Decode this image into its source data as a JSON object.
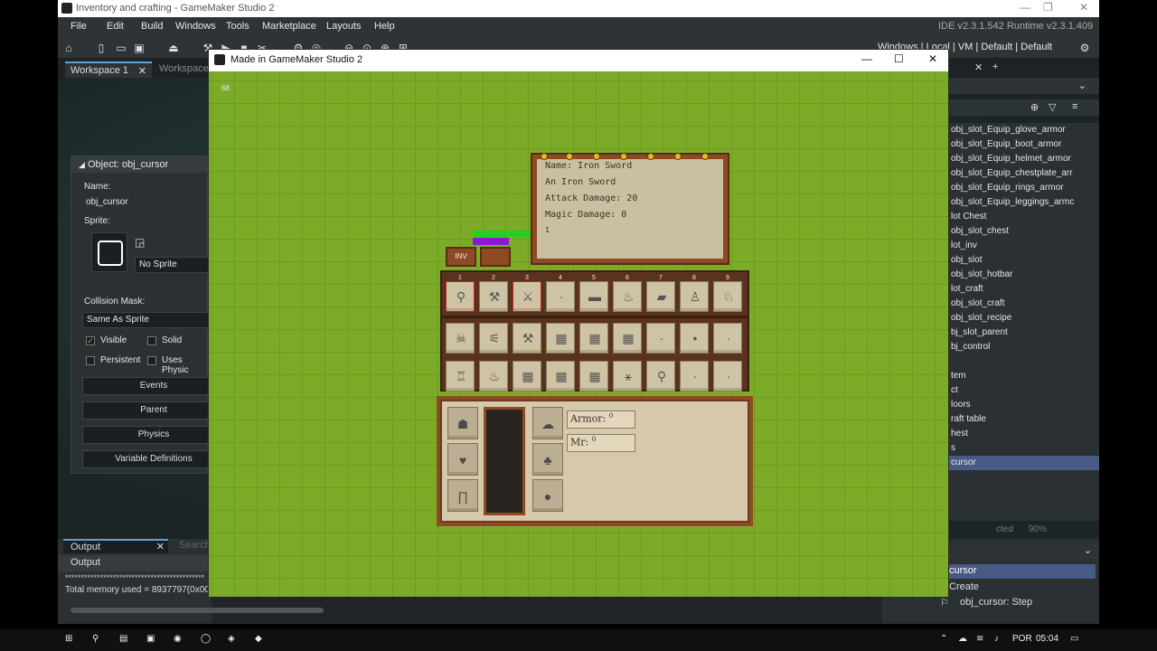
{
  "window_title": "Inventory and crafting - GameMaker Studio 2",
  "menu": [
    "File",
    "Edit",
    "Build",
    "Windows",
    "Tools",
    "Marketplace",
    "Layouts",
    "Help"
  ],
  "version": "IDE v2.3.1.542  Runtime v2.3.1.409",
  "target_bar": "Windows | Local | VM | Default | Default",
  "tabs": {
    "workspace1": "Workspace 1",
    "workspace2": "Workspace"
  },
  "object_panel": {
    "header": "Object: obj_cursor",
    "name_label": "Name:",
    "name_value": "obj_cursor",
    "sprite_label": "Sprite:",
    "sprite_value": "No Sprite",
    "collision_label": "Collision Mask:",
    "collision_value": "Same As Sprite",
    "visible": "Visible",
    "solid": "Solid",
    "persistent": "Persistent",
    "uses_physics": "Uses Physic",
    "buttons": [
      "Events",
      "Parent",
      "Physics",
      "Variable Definitions"
    ]
  },
  "output": {
    "tab": "Output",
    "search": "Search",
    "header": "Output",
    "line1": "********************************************",
    "line2": "Total memory used = 8937797(0x00"
  },
  "resources": [
    "obj_slot_Equip_glove_armor",
    "obj_slot_Equip_boot_armor",
    "obj_slot_Equip_helmet_armor",
    "obj_slot_Equip_chestplate_arr",
    "obj_slot_Equip_rings_armor",
    "obj_slot_Equip_leggings_armc",
    "lot Chest",
    "obj_slot_chest",
    "lot_inv",
    "obj_slot",
    "obj_slot_hotbar",
    "lot_craft",
    "obj_slot_craft",
    "obj_slot_recipe",
    "bj_slot_parent",
    "bj_control",
    "",
    "tem",
    "ct",
    "loors",
    "raft table",
    "hest",
    "s",
    "cursor"
  ],
  "resources_footer": {
    "left": "cted",
    "zoom": "90%"
  },
  "events_panel": {
    "selected": "cursor",
    "create": "Create",
    "step": "obj_cursor: Step"
  },
  "game": {
    "title": "Made in GameMaker Studio 2",
    "fps": "68",
    "tooltip": [
      "Name: Iron Sword",
      "An Iron Sword",
      "Attack Damage: 20",
      "Magic Damage: 0",
      "1"
    ],
    "inv_label": "INV",
    "hotbar_numbers": [
      "1",
      "2",
      "3",
      "4",
      "5",
      "6",
      "7",
      "8",
      "9"
    ],
    "armor_label": "Armor:",
    "mr_label": "Mr:",
    "armor_value": "0",
    "mr_value": "0"
  },
  "taskbar": {
    "lang": "POR",
    "time": "05:04"
  }
}
